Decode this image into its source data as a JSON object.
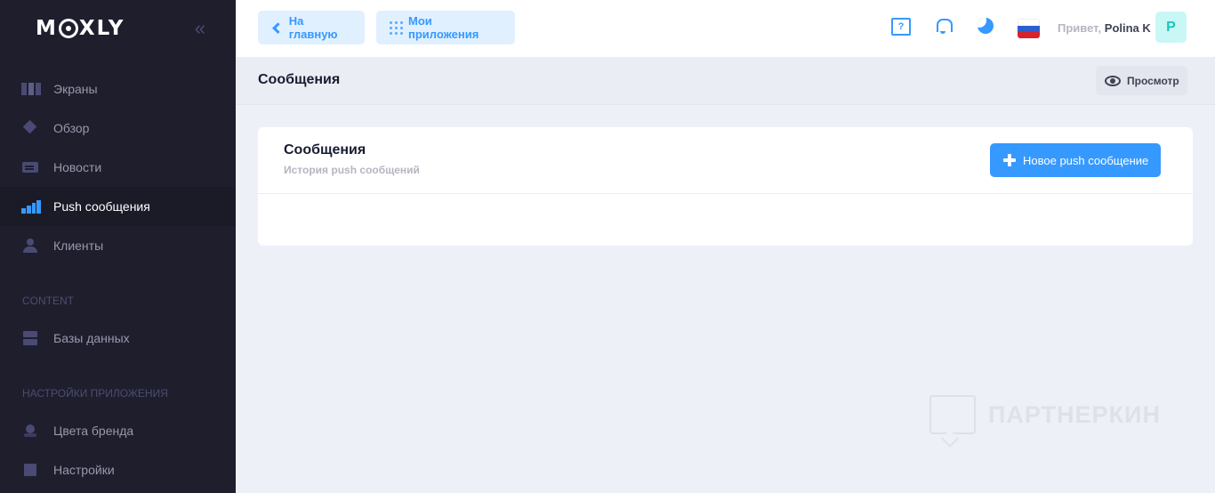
{
  "sidebar": {
    "logo": "MOXLY",
    "items": [
      {
        "label": "Экраны"
      },
      {
        "label": "Обзор"
      },
      {
        "label": "Новости"
      },
      {
        "label": "Push сообщения"
      },
      {
        "label": "Клиенты"
      }
    ],
    "sections": [
      {
        "title": "CONTENT",
        "items": [
          {
            "label": "Базы данных"
          }
        ]
      },
      {
        "title": "НАСТРОЙКИ ПРИЛОЖЕНИЯ",
        "items": [
          {
            "label": "Цвета бренда"
          },
          {
            "label": "Настройки"
          }
        ]
      }
    ],
    "active_item": "Push сообщения",
    "active_color": "#3699ff"
  },
  "header": {
    "home_label": "На главную",
    "apps_label": "Мои приложения",
    "help_icon_text": "?",
    "greeting": "Привет,",
    "user_name": "Polina K",
    "avatar_letter": "P",
    "flag_colors": [
      "#ffffff",
      "#2b5fcf",
      "#d8232a"
    ]
  },
  "subheader": {
    "title": "Сообщения",
    "preview_label": "Просмотр"
  },
  "card": {
    "title": "Сообщения",
    "subtitle": "История push сообщений",
    "new_button_label": "Новое push сообщение"
  },
  "watermark": {
    "text": "ПАРТНЕРКИН"
  }
}
